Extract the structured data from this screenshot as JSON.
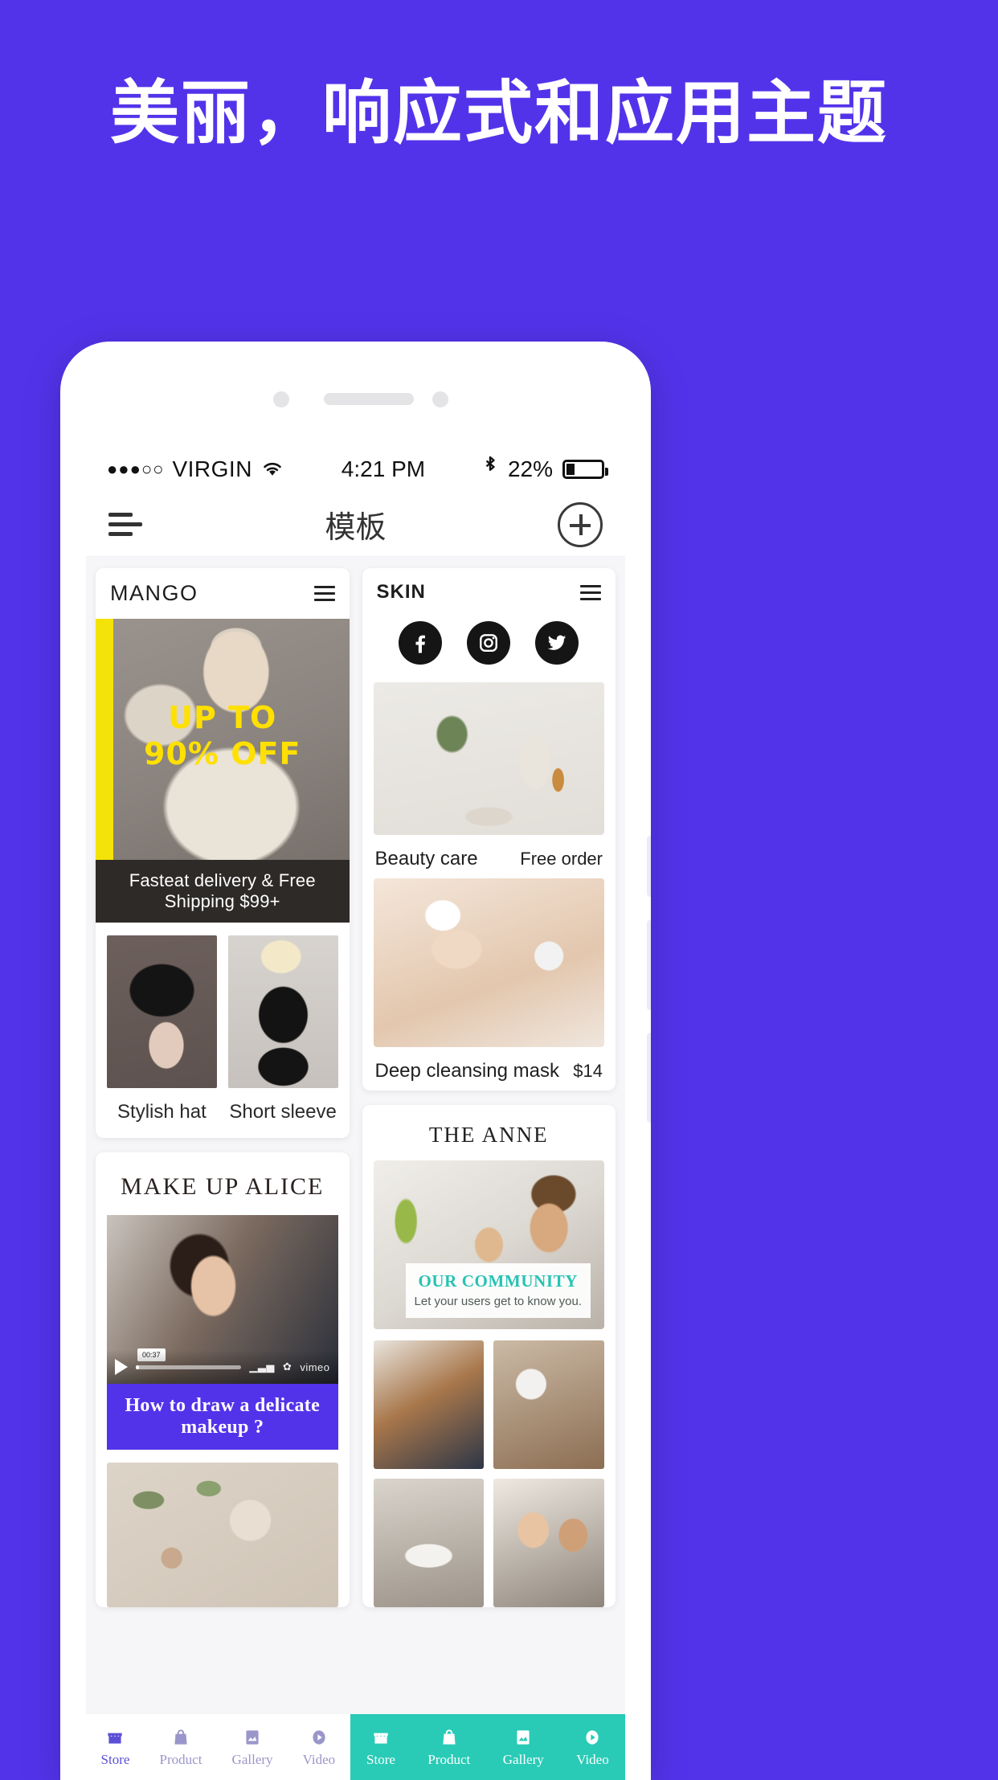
{
  "hero": {
    "headline": "美丽，响应式和应用主题"
  },
  "statusbar": {
    "signal_dots": "●●●○○",
    "carrier": "VIRGIN",
    "wifi_icon": "wifi-icon",
    "time": "4:21 PM",
    "bluetooth_icon": "bluetooth-icon",
    "battery_percent": "22%",
    "battery_icon": "battery-icon"
  },
  "appbar": {
    "menu_icon": "hamburger-menu-icon",
    "title": "模板",
    "add_icon": "plus-circle-icon"
  },
  "cards": {
    "mango": {
      "brand": "MANGO",
      "menu_icon": "hamburger-menu-icon",
      "promo_line1": "UP TO",
      "promo_line2": "90% OFF",
      "shipping_banner": "Fasteat delivery & Free Shipping $99+",
      "products": [
        {
          "label": "Stylish hat"
        },
        {
          "label": "Short sleeve"
        }
      ]
    },
    "alice": {
      "title": "MAKE UP ALICE",
      "video_provider": "vimeo",
      "play_icon": "play-icon",
      "caption": "How to draw a delicate makeup ?"
    },
    "skin": {
      "brand": "SKIN",
      "menu_icon": "hamburger-menu-icon",
      "social": [
        {
          "name": "facebook-icon"
        },
        {
          "name": "instagram-icon"
        },
        {
          "name": "twitter-icon"
        }
      ],
      "items": [
        {
          "name": "Beauty care",
          "price": "Free order"
        },
        {
          "name": "Deep cleansing mask",
          "price": "$14"
        }
      ]
    },
    "anne": {
      "title": "THE ANNE",
      "overlay_title": "OUR COMMUNITY",
      "overlay_sub": "Let your users get to know you."
    }
  },
  "bottom_nav_left": {
    "items": [
      {
        "label": "Store",
        "icon": "store-icon",
        "active": true
      },
      {
        "label": "Product",
        "icon": "bag-icon",
        "active": false
      },
      {
        "label": "Gallery",
        "icon": "image-icon",
        "active": false
      },
      {
        "label": "Video",
        "icon": "play-circle-icon",
        "active": false
      }
    ]
  },
  "bottom_nav_right": {
    "items": [
      {
        "label": "Store",
        "icon": "store-icon"
      },
      {
        "label": "Product",
        "icon": "bag-icon"
      },
      {
        "label": "Gallery",
        "icon": "image-icon"
      },
      {
        "label": "Video",
        "icon": "play-circle-icon"
      }
    ]
  },
  "colors": {
    "brand_purple": "#5333ea",
    "teal": "#29cbb6",
    "promo_yellow": "#ffe000",
    "dark": "#2d2a28"
  }
}
